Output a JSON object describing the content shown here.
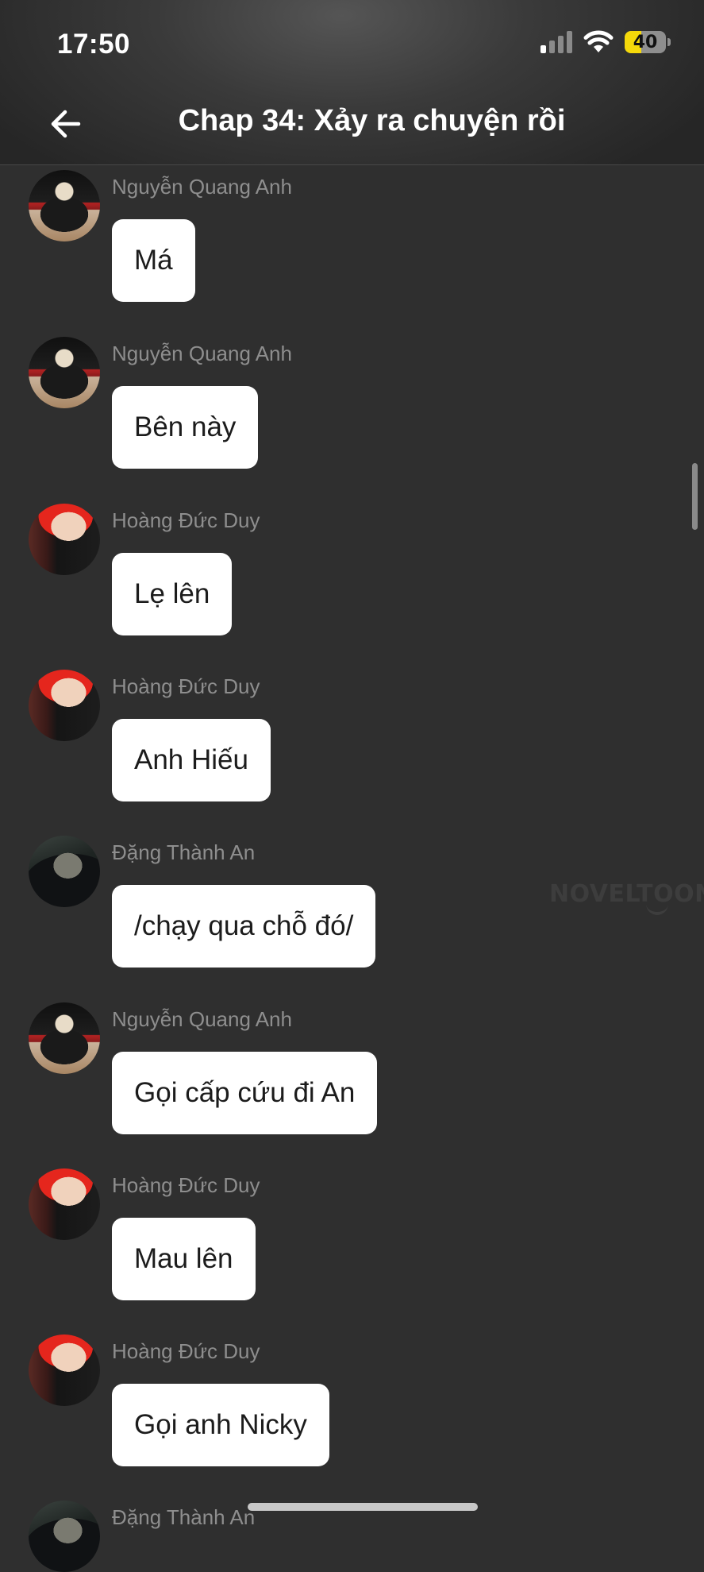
{
  "status_bar": {
    "time": "17:50",
    "battery_percent": "40",
    "battery_level": 0.4,
    "signal_bars_active": 1,
    "signal_bars_total": 4,
    "icons": [
      "signal-icon",
      "wifi-icon",
      "battery-icon"
    ]
  },
  "header": {
    "back_icon": "arrow-left-icon",
    "title": "Chap 34: Xảy ra chuyện rồi"
  },
  "messages": [
    {
      "sender": "Nguyễn Quang Anh",
      "avatar": "avatar-quang-anh",
      "text": "Má"
    },
    {
      "sender": "Nguyễn Quang Anh",
      "avatar": "avatar-quang-anh",
      "text": "Bên này"
    },
    {
      "sender": "Hoàng Đức Duy",
      "avatar": "avatar-duc-duy",
      "text": "Lẹ lên"
    },
    {
      "sender": "Hoàng Đức Duy",
      "avatar": "avatar-duc-duy",
      "text": "Anh Hiếu"
    },
    {
      "sender": "Đặng Thành An",
      "avatar": "avatar-thanh-an",
      "text": "/chạy qua chỗ đó/"
    },
    {
      "sender": "Nguyễn Quang Anh",
      "avatar": "avatar-quang-anh",
      "text": "Gọi cấp cứu đi An"
    },
    {
      "sender": "Hoàng Đức Duy",
      "avatar": "avatar-duc-duy",
      "text": "Mau lên"
    },
    {
      "sender": "Hoàng Đức Duy",
      "avatar": "avatar-duc-duy",
      "text": "Gọi anh Nicky"
    },
    {
      "sender": "Đặng Thành An",
      "avatar": "avatar-thanh-an",
      "text": ""
    }
  ],
  "watermark": "NOVELTOON",
  "colors": {
    "background": "#2f2f2f",
    "bubble": "#ffffff",
    "sender_name": "#8e8e8e",
    "battery_accent": "#f5d90a"
  }
}
